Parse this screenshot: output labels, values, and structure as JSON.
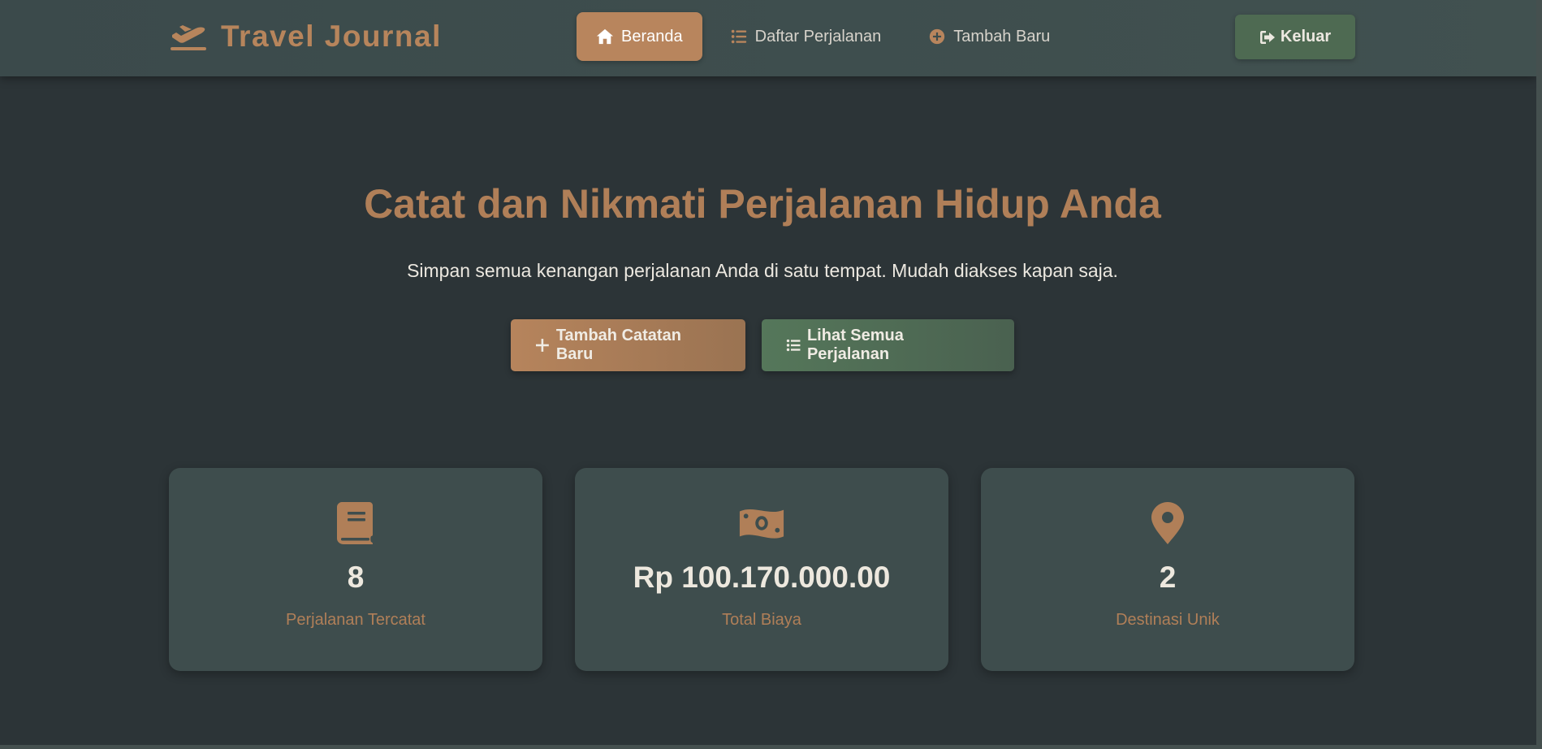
{
  "brand": {
    "name": "Travel Journal",
    "icon": "plane-departure-icon"
  },
  "nav": {
    "items": [
      {
        "label": "Beranda",
        "icon": "home-icon",
        "active": true
      },
      {
        "label": "Daftar Perjalanan",
        "icon": "list-icon",
        "active": false
      },
      {
        "label": "Tambah Baru",
        "icon": "plus-circle-icon",
        "active": false
      }
    ],
    "logout_label": "Keluar"
  },
  "hero": {
    "title": "Catat dan Nikmati Perjalanan Hidup Anda",
    "subtitle": "Simpan semua kenangan perjalanan Anda di satu tempat. Mudah diakses kapan saja.",
    "primary_button": "Tambah Catatan Baru",
    "secondary_button": "Lihat Semua Perjalanan"
  },
  "stats": [
    {
      "icon": "book-icon",
      "value": "8",
      "label": "Perjalanan Tercatat"
    },
    {
      "icon": "money-bill-icon",
      "value": "Rp 100.170.000.00",
      "label": "Total Biaya"
    },
    {
      "icon": "map-marker-icon",
      "value": "2",
      "label": "Destinasi Unik"
    }
  ],
  "colors": {
    "accent": "#b8855d",
    "success": "#4e6a52",
    "background": "#2c3437",
    "card": "#3e4d4d"
  }
}
